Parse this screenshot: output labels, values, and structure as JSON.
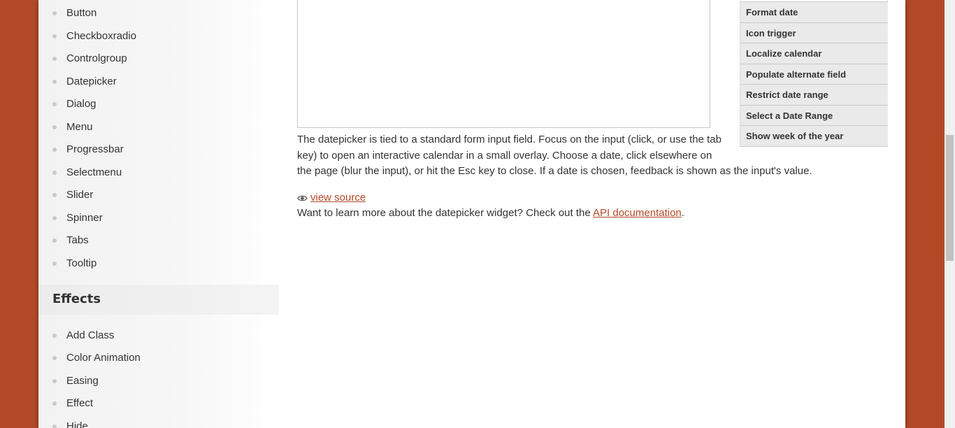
{
  "sidebar": {
    "widgets": [
      {
        "label": "Button"
      },
      {
        "label": "Checkboxradio"
      },
      {
        "label": "Controlgroup"
      },
      {
        "label": "Datepicker"
      },
      {
        "label": "Dialog"
      },
      {
        "label": "Menu"
      },
      {
        "label": "Progressbar"
      },
      {
        "label": "Selectmenu"
      },
      {
        "label": "Slider"
      },
      {
        "label": "Spinner"
      },
      {
        "label": "Tabs"
      },
      {
        "label": "Tooltip"
      }
    ],
    "effects_header": "Effects",
    "effects": [
      {
        "label": "Add Class"
      },
      {
        "label": "Color Animation"
      },
      {
        "label": "Easing"
      },
      {
        "label": "Effect"
      },
      {
        "label": "Hide"
      }
    ]
  },
  "examples": [
    {
      "label": "Format date"
    },
    {
      "label": "Icon trigger"
    },
    {
      "label": "Localize calendar"
    },
    {
      "label": "Populate alternate field"
    },
    {
      "label": "Restrict date range"
    },
    {
      "label": "Select a Date Range"
    },
    {
      "label": "Show week of the year"
    }
  ],
  "main": {
    "description": "The datepicker is tied to a standard form input field. Focus on the input (click, or use the tab key) to open an interactive calendar in a small overlay. Choose a date, click elsewhere on the page (blur the input), or hit the Esc key to close. If a date is chosen, feedback is shown as the input's value.",
    "view_source": "view source",
    "learn_more_prefix": "Want to learn more about the datepicker widget? Check out the ",
    "api_link": "API documentation",
    "learn_more_suffix": "."
  },
  "colors": {
    "background": "#b24926",
    "link": "#b24926",
    "text": "#333333",
    "example_item_bg": "#eaeaea"
  },
  "icons": {
    "view_source": "eye-icon"
  }
}
